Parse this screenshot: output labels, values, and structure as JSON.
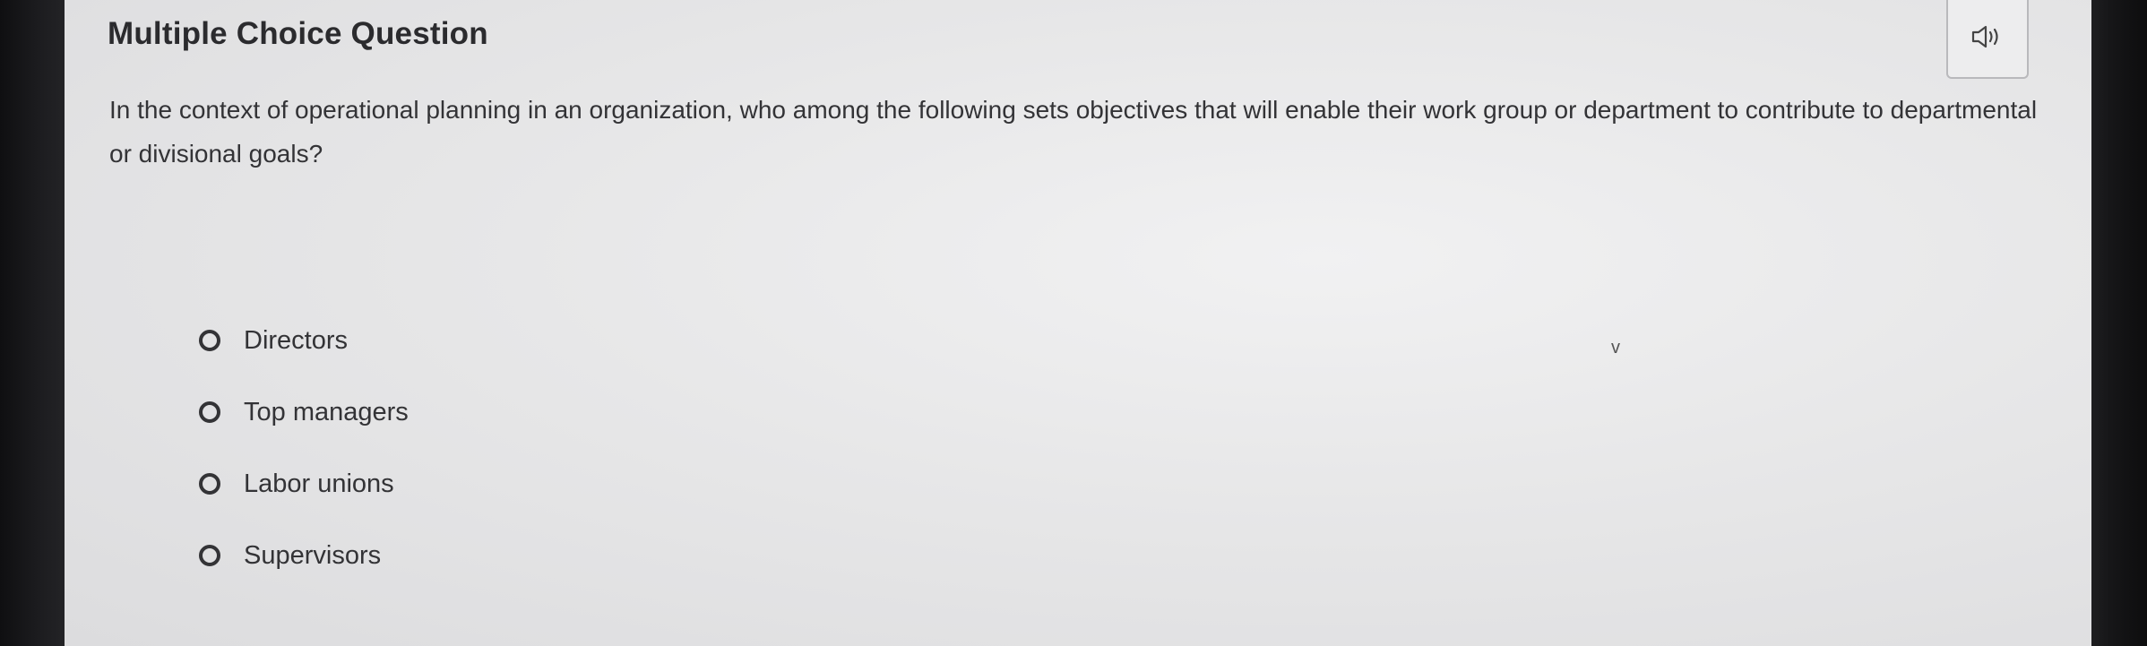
{
  "header": {
    "title": "Multiple Choice Question",
    "audio_icon": "speaker-icon"
  },
  "question": {
    "text": "In the context of operational planning in an organization, who among the following sets objectives that will enable their work group or department to contribute to departmental or divisional goals?"
  },
  "options": [
    {
      "label": "Directors",
      "selected": false
    },
    {
      "label": "Top managers",
      "selected": false
    },
    {
      "label": "Labor unions",
      "selected": false
    },
    {
      "label": "Supervisors",
      "selected": false
    }
  ],
  "misc": {
    "stray_mark": "v"
  }
}
